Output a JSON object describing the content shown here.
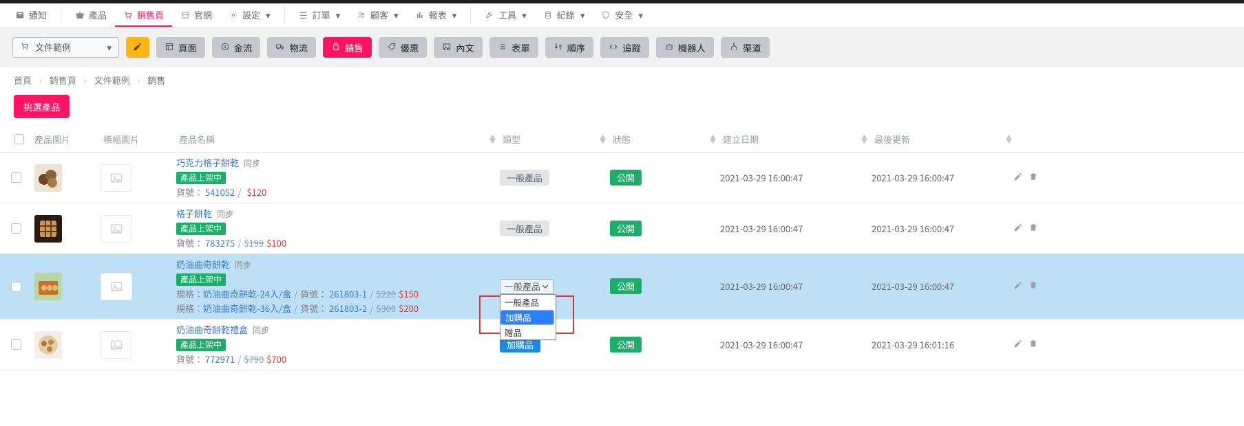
{
  "nav": {
    "items": [
      {
        "icon": "mail",
        "label": "通知"
      },
      {
        "icon": "gift",
        "label": "產品"
      },
      {
        "icon": "cart",
        "label": "銷售頁",
        "active": true
      },
      {
        "icon": "store",
        "label": "官網"
      },
      {
        "icon": "gear",
        "label": "設定",
        "caret": true
      }
    ],
    "items2": [
      {
        "icon": "list",
        "label": "訂單",
        "caret": true
      },
      {
        "icon": "people",
        "label": "顧客",
        "caret": true
      },
      {
        "icon": "chart",
        "label": "報表",
        "caret": true
      }
    ],
    "items3": [
      {
        "icon": "wrench",
        "label": "工具",
        "caret": true
      },
      {
        "icon": "db",
        "label": "紀錄",
        "caret": true
      },
      {
        "icon": "shield",
        "label": "安全",
        "caret": true
      }
    ]
  },
  "toolbar": {
    "dropdown": {
      "icon": "cart",
      "label": "文件範例"
    },
    "buttons": [
      {
        "kind": "orange",
        "icon": "edit",
        "label": ""
      },
      {
        "kind": "gray",
        "icon": "layout",
        "label": "頁面"
      },
      {
        "kind": "gray",
        "icon": "dollar",
        "label": "金流"
      },
      {
        "kind": "gray",
        "icon": "truck",
        "label": "物流"
      },
      {
        "kind": "pink",
        "icon": "bag",
        "label": "銷售"
      },
      {
        "kind": "gray",
        "icon": "tag",
        "label": "優惠"
      },
      {
        "kind": "gray",
        "icon": "image",
        "label": "內文"
      },
      {
        "kind": "gray",
        "icon": "list",
        "label": "表單"
      },
      {
        "kind": "gray",
        "icon": "swap",
        "label": "順序"
      },
      {
        "kind": "gray",
        "icon": "code",
        "label": "追蹤"
      },
      {
        "kind": "gray",
        "icon": "robot",
        "label": "機器人"
      },
      {
        "kind": "gray",
        "icon": "branch",
        "label": "渠道"
      }
    ]
  },
  "breadcrumbs": [
    {
      "label": "首頁"
    },
    {
      "label": "銷售頁"
    },
    {
      "label": "文件範例"
    },
    {
      "label": "銷售"
    }
  ],
  "pick_label": "挑選產品",
  "columns": {
    "c1": "產品圖片",
    "c2": "橫幅圖片",
    "c3": "產品名稱",
    "c4": "類型",
    "c5": "狀態",
    "c6": "建立日期",
    "c7": "最後更新"
  },
  "typeOptions": [
    "一般產品",
    "加購品",
    "贈品"
  ],
  "rows": [
    {
      "title": "巧克力格子餅乾",
      "sync": "同步",
      "status_badge": "產品上架中",
      "sku_label": "貨號：",
      "sku": "541052",
      "old": "",
      "new": "$120",
      "type_label": "一般產品",
      "type_mode": "tag",
      "status": "公開",
      "created": "2021-03-29 16:00:47",
      "updated": "2021-03-29 16:00:47",
      "selected": false
    },
    {
      "title": "格子餅乾",
      "sync": "同步",
      "status_badge": "產品上架中",
      "sku_label": "貨號：",
      "sku": "783275",
      "old": "$199",
      "new": "$100",
      "type_label": "一般產品",
      "type_mode": "tag",
      "status": "公開",
      "created": "2021-03-29 16:00:47",
      "updated": "2021-03-29 16:00:47",
      "selected": false
    },
    {
      "title": "奶油曲奇餅乾",
      "sync": "同步",
      "status_badge": "產品上架中",
      "specs": [
        {
          "spec_label": "規格：",
          "spec_link": "奶油曲奇餅乾-24入/盒",
          "sku_label": "貨號：",
          "sku": "261803-1",
          "old": "$220",
          "new": "$150"
        },
        {
          "spec_label": "規格：",
          "spec_link": "奶油曲奇餅乾-36入/盒",
          "sku_label": "貨號：",
          "sku": "261803-2",
          "old": "$300",
          "new": "$200"
        }
      ],
      "type_label": "一般產品",
      "type_mode": "select",
      "dropdown_selected_index": 1,
      "status": "公開",
      "created": "2021-03-29 16:00:47",
      "updated": "2021-03-29 16:00:47",
      "selected": true
    },
    {
      "title": "奶油曲奇餅乾禮盒",
      "sync": "同步",
      "status_badge": "產品上架中",
      "sku_label": "貨號：",
      "sku": "772971",
      "old": "$790",
      "new": "$700",
      "type_label": "加購品",
      "type_mode": "tag-blue",
      "status": "公開",
      "created": "2021-03-29 16:00:47",
      "updated": "2021-03-29 16:01:16",
      "selected": false
    }
  ]
}
